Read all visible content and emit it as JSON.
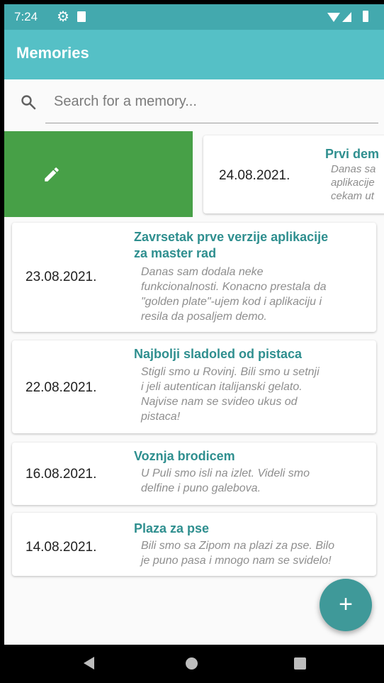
{
  "status_bar": {
    "time": "7:24",
    "icons": [
      "gear-icon",
      "sd-card-icon",
      "wifi-icon",
      "signal-icon",
      "battery-icon"
    ]
  },
  "app_bar": {
    "title": "Memories",
    "color": "#55c0c6"
  },
  "search": {
    "placeholder": "Search for a memory...",
    "icon": "search-icon"
  },
  "swiped_card": {
    "action_icon": "pencil-icon",
    "action_color": "#47a047",
    "date": "24.08.2021.",
    "title": "Prvi dem",
    "description_lines": [
      "Danas sa",
      "aplikacije",
      "cekam ut"
    ]
  },
  "memories": [
    {
      "date": "23.08.2021.",
      "title_lines": [
        "Zavrsetak prve verzije aplikacije",
        "za master rad"
      ],
      "description_lines": [
        "Danas sam dodala neke",
        "funkcionalnosti. Konacno prestala da",
        "\"golden plate\"-ujem kod i aplikaciju i",
        "resila da posaljem demo."
      ]
    },
    {
      "date": "22.08.2021.",
      "title_lines": [
        "Najbolji sladoled od pistaca"
      ],
      "description_lines": [
        "Stigli smo u Rovinj. Bili smo u setnji",
        "i jeli autentican italijanski gelato.",
        "Najvise nam se svideo ukus od",
        "pistaca!"
      ]
    },
    {
      "date": "16.08.2021.",
      "title_lines": [
        "Voznja brodicem"
      ],
      "description_lines": [
        "U Puli smo isli na izlet. Videli smo",
        "delfine i puno galebova."
      ]
    },
    {
      "date": "14.08.2021.",
      "title_lines": [
        "Plaza za pse"
      ],
      "description_lines": [
        "Bili smo sa Zipom na plazi za pse. Bilo",
        "je puno pasa i mnogo nam se svidelo!"
      ]
    }
  ],
  "fab": {
    "label": "+",
    "icon": "add-icon",
    "color": "#3f9999"
  },
  "nav_bar": {
    "buttons": [
      "back-icon",
      "home-icon",
      "recents-icon"
    ]
  }
}
